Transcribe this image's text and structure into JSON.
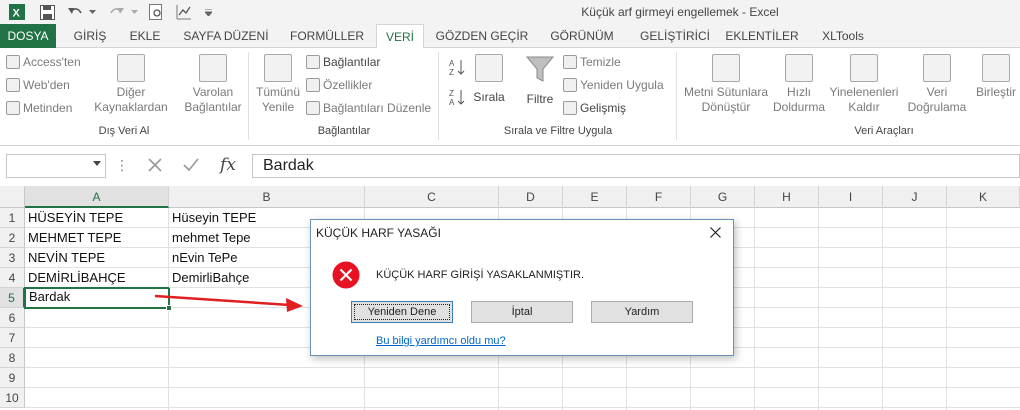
{
  "window": {
    "title": "Küçük arf girmeyi engellemek - Excel"
  },
  "tabs": [
    {
      "label": "DOSYA"
    },
    {
      "label": "GİRİŞ"
    },
    {
      "label": "EKLE"
    },
    {
      "label": "SAYFA DÜZENİ"
    },
    {
      "label": "FORMÜLLER"
    },
    {
      "label": "VERİ"
    },
    {
      "label": "GÖZDEN GEÇİR"
    },
    {
      "label": "GÖRÜNÜM"
    },
    {
      "label": "GELİŞTİRİCİ"
    },
    {
      "label": "EKLENTİLER"
    },
    {
      "label": "XLTools"
    }
  ],
  "ribbon": {
    "external": {
      "access": "Access'ten",
      "web": "Web'den",
      "text": "Metinden",
      "other_l1": "Diğer",
      "other_l2": "Kaynaklardan",
      "existing_l1": "Varolan",
      "existing_l2": "Bağlantılar",
      "group": "Dış Veri Al"
    },
    "connections": {
      "refresh_l1": "Tümünü",
      "refresh_l2": "Yenile",
      "connections": "Bağlantılar",
      "properties": "Özellikler",
      "edit_links": "Bağlantıları Düzenle",
      "group": "Bağlantılar"
    },
    "sortfilter": {
      "sort": "Sırala",
      "filter": "Filtre",
      "clear": "Temizle",
      "reapply": "Yeniden Uygula",
      "advanced": "Gelişmiş",
      "group": "Sırala ve Filtre Uygula"
    },
    "datatools": {
      "t2c_l1": "Metni Sütunlara",
      "t2c_l2": "Dönüştür",
      "flash_l1": "Hızlı",
      "flash_l2": "Doldurma",
      "dup_l1": "Yinelenenleri",
      "dup_l2": "Kaldır",
      "valid_l1": "Veri",
      "valid_l2": "Doğrulama",
      "consol": "Birleştir",
      "group": "Veri Araçları"
    }
  },
  "formula_bar": {
    "name_box": "",
    "formula": "Bardak",
    "fx": "fx"
  },
  "grid": {
    "columns": [
      "A",
      "B",
      "C",
      "D",
      "E",
      "F",
      "G",
      "H",
      "I",
      "J",
      "K"
    ],
    "rows": [
      "1",
      "2",
      "3",
      "4",
      "5",
      "6",
      "7",
      "8",
      "9",
      "10"
    ],
    "colA": [
      "HÜSEYİN TEPE",
      "MEHMET TEPE",
      "NEVİN TEPE",
      "DEMİRLİBAHÇE",
      "Bardak"
    ],
    "colB": [
      "Hüseyin TEPE",
      "mehmet Tepe",
      "nEvin TePe",
      "DemirliBahçe"
    ]
  },
  "dialog": {
    "title": "KÜÇÜK HARF YASAĞI",
    "message": "KÜÇÜK HARF GİRİŞİ YASAKLANMIŞTIR.",
    "retry": "Yeniden Dene",
    "cancel": "İptal",
    "help": "Yardım",
    "link": "Bu bilgi yardımcı oldu mu?"
  },
  "colors": {
    "excel_green": "#217346",
    "error_red": "#e81123",
    "arrow_red": "#e02020"
  }
}
